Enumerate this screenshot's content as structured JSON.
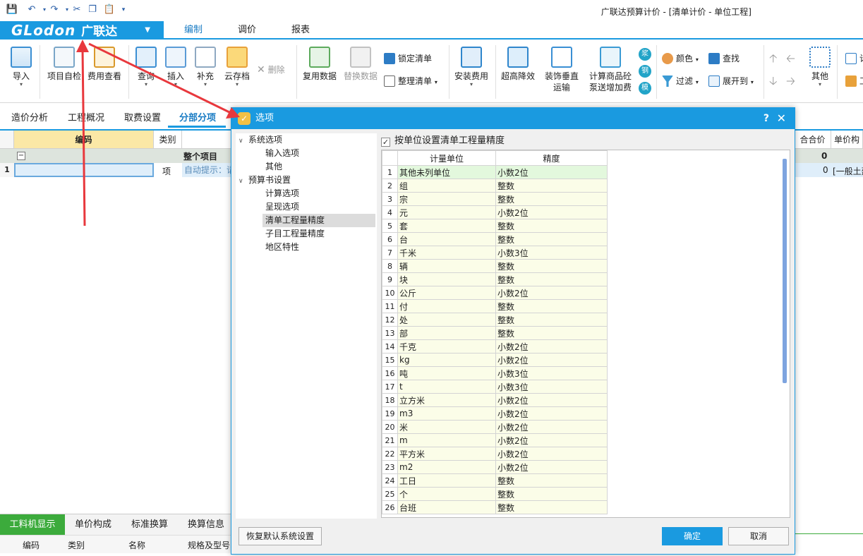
{
  "window": {
    "title": "广联达预算计价 - [清单计价 - 单位工程]"
  },
  "brand": {
    "logo_latin": "GLodon",
    "logo_cn": "广联达",
    "logo_dropdown": "▼"
  },
  "menu_tabs": [
    {
      "label": "编制",
      "active": true
    },
    {
      "label": "调价"
    },
    {
      "label": "报表"
    }
  ],
  "ribbon": {
    "import": "导入",
    "self_check": "项目自检",
    "fee_view": "费用查看",
    "query": "查询",
    "insert": "插入",
    "supplement": "补充",
    "cloud_save": "云存档",
    "delete": "删除",
    "reuse_data": "复用数据",
    "replace_data": "替换数据",
    "lock_list": "锁定清单",
    "tidy_list": "整理清单",
    "install_fee": "安装费用",
    "high_rise": "超高降效",
    "decor_vertical_1": "装饰垂直",
    "decor_vertical_2": "运输",
    "concrete_1": "计算商品砼",
    "concrete_2": "泵送增加费",
    "circ_1": "浆",
    "circ_2": "钢",
    "circ_3": "模",
    "color": "颜色",
    "find": "查找",
    "filter": "过滤",
    "expand_to": "展开到",
    "other": "其他",
    "right_cut_1": "计",
    "right_cut_2": "工"
  },
  "sub_tabs": [
    {
      "label": "造价分析"
    },
    {
      "label": "工程概况"
    },
    {
      "label": "取费设置"
    },
    {
      "label": "分部分项",
      "active": true
    }
  ],
  "grid": {
    "col_code": "编码",
    "col_type": "类别",
    "root_row_label": "整个项目",
    "row1_num": "1",
    "row1_type": "项",
    "row1_hint": "自动提示：请",
    "right_col_total": "合合价",
    "right_col_unit": "单价构",
    "right_root_value": "0",
    "right_row1_value": "0",
    "right_row1_text": "[一般土建"
  },
  "bottom_tabs": [
    {
      "label": "工料机显示",
      "active": true
    },
    {
      "label": "单价构成"
    },
    {
      "label": "标准换算"
    },
    {
      "label": "换算信息"
    }
  ],
  "bottom_headers": [
    "编码",
    "类别",
    "名称",
    "规格及型号"
  ],
  "dialog": {
    "title": "选项",
    "help": "?",
    "close": "✕",
    "tree": [
      {
        "label": "系统选项",
        "level": 0,
        "expanded": true
      },
      {
        "label": "输入选项",
        "level": 1
      },
      {
        "label": "其他",
        "level": 1
      },
      {
        "label": "预算书设置",
        "level": 0,
        "expanded": true
      },
      {
        "label": "计算选项",
        "level": 1
      },
      {
        "label": "呈现选项",
        "level": 1
      },
      {
        "label": "清单工程量精度",
        "level": 1,
        "selected": true
      },
      {
        "label": "子目工程量精度",
        "level": 1
      },
      {
        "label": "地区特性",
        "level": 1
      }
    ],
    "checkbox_label": "按单位设置清单工程量精度",
    "checkbox_checked": true,
    "table_headers": [
      "计量单位",
      "精度"
    ],
    "rows": [
      {
        "n": "1",
        "unit": "其他未列单位",
        "precision": "小数2位"
      },
      {
        "n": "2",
        "unit": "组",
        "precision": "整数"
      },
      {
        "n": "3",
        "unit": "宗",
        "precision": "整数"
      },
      {
        "n": "4",
        "unit": "元",
        "precision": "小数2位"
      },
      {
        "n": "5",
        "unit": "套",
        "precision": "整数"
      },
      {
        "n": "6",
        "unit": "台",
        "precision": "整数"
      },
      {
        "n": "7",
        "unit": "千米",
        "precision": "小数3位"
      },
      {
        "n": "8",
        "unit": "辆",
        "precision": "整数"
      },
      {
        "n": "9",
        "unit": "块",
        "precision": "整数"
      },
      {
        "n": "10",
        "unit": "公斤",
        "precision": "小数2位"
      },
      {
        "n": "11",
        "unit": "付",
        "precision": "整数"
      },
      {
        "n": "12",
        "unit": "处",
        "precision": "整数"
      },
      {
        "n": "13",
        "unit": "部",
        "precision": "整数"
      },
      {
        "n": "14",
        "unit": "千克",
        "precision": "小数2位"
      },
      {
        "n": "15",
        "unit": "kg",
        "precision": "小数2位"
      },
      {
        "n": "16",
        "unit": "吨",
        "precision": "小数3位"
      },
      {
        "n": "17",
        "unit": "t",
        "precision": "小数3位"
      },
      {
        "n": "18",
        "unit": "立方米",
        "precision": "小数2位"
      },
      {
        "n": "19",
        "unit": "m3",
        "precision": "小数2位"
      },
      {
        "n": "20",
        "unit": "米",
        "precision": "小数2位"
      },
      {
        "n": "21",
        "unit": "m",
        "precision": "小数2位"
      },
      {
        "n": "22",
        "unit": "平方米",
        "precision": "小数2位"
      },
      {
        "n": "23",
        "unit": "m2",
        "precision": "小数2位"
      },
      {
        "n": "24",
        "unit": "工日",
        "precision": "整数"
      },
      {
        "n": "25",
        "unit": "个",
        "precision": "整数"
      },
      {
        "n": "26",
        "unit": "台班",
        "precision": "整数"
      }
    ],
    "restore_button": "恢复默认系统设置",
    "ok_button": "确定",
    "cancel_button": "取消"
  },
  "colors": {
    "accent": "#1a9ae0",
    "arrow": "#e8383d",
    "active_green": "#3cab3c"
  }
}
